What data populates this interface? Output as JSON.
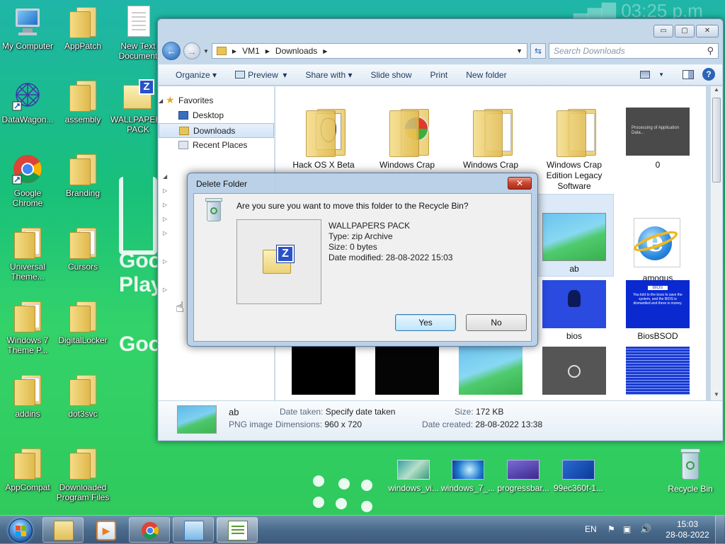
{
  "desktop": {
    "icons": [
      {
        "label": "My Computer"
      },
      {
        "label": "AppPatch"
      },
      {
        "label": "New Text Document"
      },
      {
        "label": "DataWagon..."
      },
      {
        "label": "assembly"
      },
      {
        "label": "WALLPAPERS PACK"
      },
      {
        "label": "Google Chrome"
      },
      {
        "label": "Branding"
      },
      {
        "label": "Universal Theme..."
      },
      {
        "label": "Cursors"
      },
      {
        "label": "Windows 7 Theme P..."
      },
      {
        "label": "DigitalLocker"
      },
      {
        "label": "addins"
      },
      {
        "label": "dot3svc"
      },
      {
        "label": "AppCompat"
      },
      {
        "label": "Downloaded Program Files"
      },
      {
        "label": "windows_vi..."
      },
      {
        "label": "windows_7_..."
      },
      {
        "label": "progressbar..."
      },
      {
        "label": "99ec360f-1..."
      },
      {
        "label": "Recycle Bin"
      }
    ]
  },
  "explorer": {
    "controls": {
      "minimize": "▭",
      "maximize": "▢",
      "close": "✕"
    },
    "breadcrumb": [
      "VM1",
      "Downloads"
    ],
    "search_placeholder": "Search Downloads",
    "toolbar": {
      "organize": "Organize",
      "preview": "Preview",
      "share_with": "Share with",
      "slide_show": "Slide show",
      "print": "Print",
      "new_folder": "New folder"
    },
    "nav": {
      "favorites": "Favorites",
      "desktop": "Desktop",
      "downloads": "Downloads",
      "recent_places": "Recent Places"
    },
    "files": [
      {
        "name": "Hack OS X Beta"
      },
      {
        "name": "Windows Crap"
      },
      {
        "name": "Windows Crap"
      },
      {
        "name": "Windows Crap Edition Legacy Software"
      },
      {
        "name": "0"
      },
      {
        "name": "ab"
      },
      {
        "name": "amogus"
      },
      {
        "name": "bios"
      },
      {
        "name": "BiosBSOD"
      }
    ],
    "thumb_text": {
      "zero": "Processing of Application Data...",
      "bios_title": "BIOS",
      "bios_body": "You told to the boss to save the system, and the BIOS is dismantled and there is money."
    },
    "details": {
      "name": "ab",
      "type": "PNG image",
      "date_taken_label": "Date taken:",
      "date_taken_value": "Specify date taken",
      "dimensions_label": "Dimensions:",
      "dimensions_value": "960 x 720",
      "size_label": "Size:",
      "size_value": "172 KB",
      "date_created_label": "Date created:",
      "date_created_value": "28-08-2022 13:38"
    }
  },
  "dialog": {
    "title": "Delete Folder",
    "close": "✕",
    "message": "Are you sure you want to move this folder to the Recycle Bin?",
    "zip_letter": "Z",
    "file_name": "WALLPAPERS PACK",
    "file_type": "Type: zip Archive",
    "file_size": "Size: 0 bytes",
    "file_date": "Date modified: 28-08-2022 15:03",
    "yes": "Yes",
    "no": "No"
  },
  "taskbar": {
    "lang": "EN",
    "time": "15:03",
    "date": "28-08-2022"
  }
}
